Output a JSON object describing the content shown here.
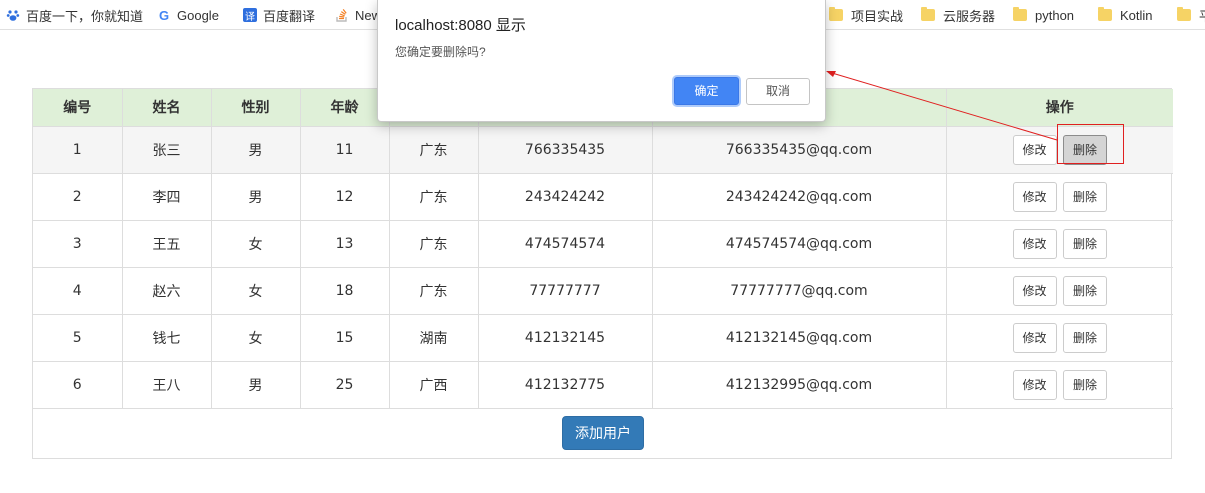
{
  "bookmarks": [
    {
      "label": "百度一下，你就知道",
      "icon": "baidu-paw-icon"
    },
    {
      "label": "Google",
      "icon": "google-icon"
    },
    {
      "label": "百度翻译",
      "icon": "translate-icon"
    },
    {
      "label": "New",
      "icon": "stackoverflow-icon"
    },
    {
      "label": "项目实战",
      "icon": "folder-icon"
    },
    {
      "label": "云服务器",
      "icon": "folder-icon"
    },
    {
      "label": "python",
      "icon": "folder-icon"
    },
    {
      "label": "Kotlin",
      "icon": "folder-icon"
    },
    {
      "label": "平",
      "icon": "folder-icon"
    }
  ],
  "dialog": {
    "title": "localhost:8080 显示",
    "message": "您确定要删除吗?",
    "ok_label": "确定",
    "cancel_label": "取消"
  },
  "table": {
    "headers": [
      "编号",
      "姓名",
      "性别",
      "年龄",
      "",
      "",
      "",
      "操作"
    ],
    "rows": [
      {
        "id": "1",
        "name": "张三",
        "gender": "男",
        "age": "11",
        "province": "广东",
        "qq": "766335435",
        "email": "766335435@qq.com"
      },
      {
        "id": "2",
        "name": "李四",
        "gender": "男",
        "age": "12",
        "province": "广东",
        "qq": "243424242",
        "email": "243424242@qq.com"
      },
      {
        "id": "3",
        "name": "王五",
        "gender": "女",
        "age": "13",
        "province": "广东",
        "qq": "474574574",
        "email": "474574574@qq.com"
      },
      {
        "id": "4",
        "name": "赵六",
        "gender": "女",
        "age": "18",
        "province": "广东",
        "qq": "77777777",
        "email": "77777777@qq.com"
      },
      {
        "id": "5",
        "name": "钱七",
        "gender": "女",
        "age": "15",
        "province": "湖南",
        "qq": "412132145",
        "email": "412132145@qq.com"
      },
      {
        "id": "6",
        "name": "王八",
        "gender": "男",
        "age": "25",
        "province": "广西",
        "qq": "412132775",
        "email": "412132995@qq.com"
      }
    ],
    "edit_label": "修改",
    "delete_label": "删除",
    "add_user_label": "添加用户"
  },
  "colors": {
    "header_bg": "#dff0d8",
    "primary": "#337ab7",
    "dialog_ok": "#4285f4",
    "annotation": "#e02020"
  }
}
